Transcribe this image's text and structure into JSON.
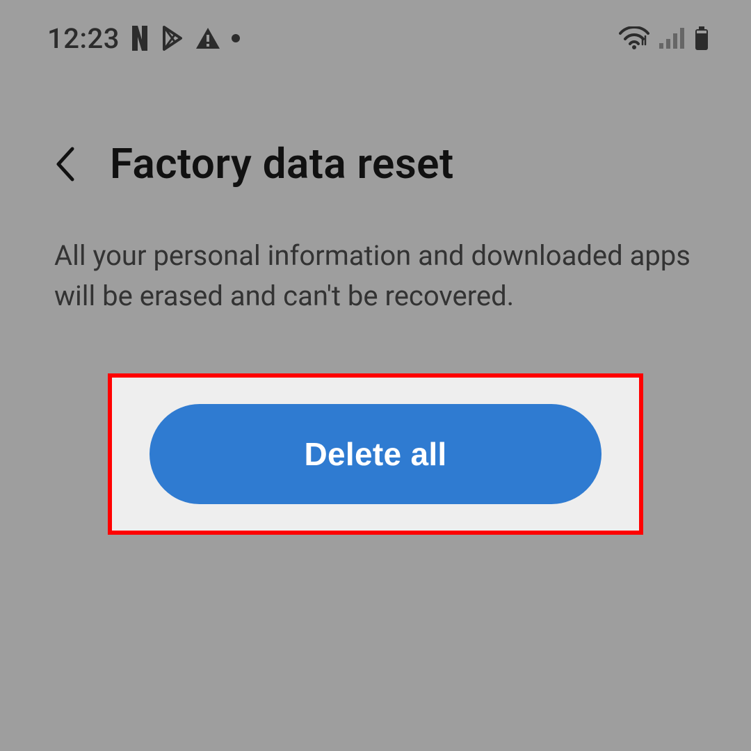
{
  "status_bar": {
    "time": "12:23",
    "icons_left": {
      "netflix": "netflix-icon",
      "play_store": "play-store-icon",
      "warning": "warning-icon",
      "dot": "dot-icon"
    },
    "icons_right": {
      "wifi": "wifi-icon",
      "signal": "signal-icon",
      "battery": "battery-icon"
    }
  },
  "header": {
    "title": "Factory data reset"
  },
  "body": {
    "description": "All your personal information and downloaded apps will be erased and can't be recovered."
  },
  "action": {
    "delete_all_label": "Delete all"
  },
  "colors": {
    "accent": "#2f7bd1",
    "highlight_border": "#ff0000",
    "highlight_bg": "#eeeeee",
    "page_bg": "#9e9e9e"
  }
}
